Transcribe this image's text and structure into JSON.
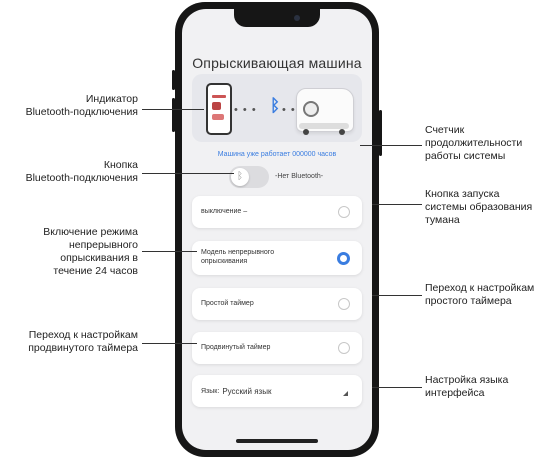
{
  "app": {
    "title": "Опрыскивающая машина",
    "runtime_text": "Машина уже работает 000000 часов",
    "bt_status": "-Нет Bluetooth-",
    "icons": {
      "bluetooth": "bluetooth-icon",
      "phone": "phone-icon",
      "machine": "machine-icon"
    }
  },
  "options": [
    {
      "label": "выключение –",
      "selected": false
    },
    {
      "label": "Модель непрерывного опрыскивания",
      "selected": true
    },
    {
      "label": "Простой таймер",
      "selected": false
    },
    {
      "label": "Продвинутый таймер",
      "selected": false
    }
  ],
  "language": {
    "label": "Язык:",
    "value": "Русский язык"
  },
  "callouts": {
    "bt_indicator": "Индикатор\nBluetooth-подключения",
    "bt_button": "Кнопка\nBluetooth-подключения",
    "continuous": "Включение режима\nнепрерывного\nопрыскивания в\nтечение 24 часов",
    "advanced_timer": "Переход к настройкам\nпродвинутого таймера",
    "runtime_counter": "Счетчик\nпродолжительности\nработы системы",
    "fog_start": "Кнопка запуска\nсистемы образования\nтумана",
    "simple_timer": "Переход к настройкам\nпростого таймера",
    "language_setting": "Настройка языка\nинтерфейса"
  },
  "colors": {
    "accent": "#3a7de0",
    "phone_frame": "#161616",
    "screen_bg": "#f1f1f3"
  }
}
